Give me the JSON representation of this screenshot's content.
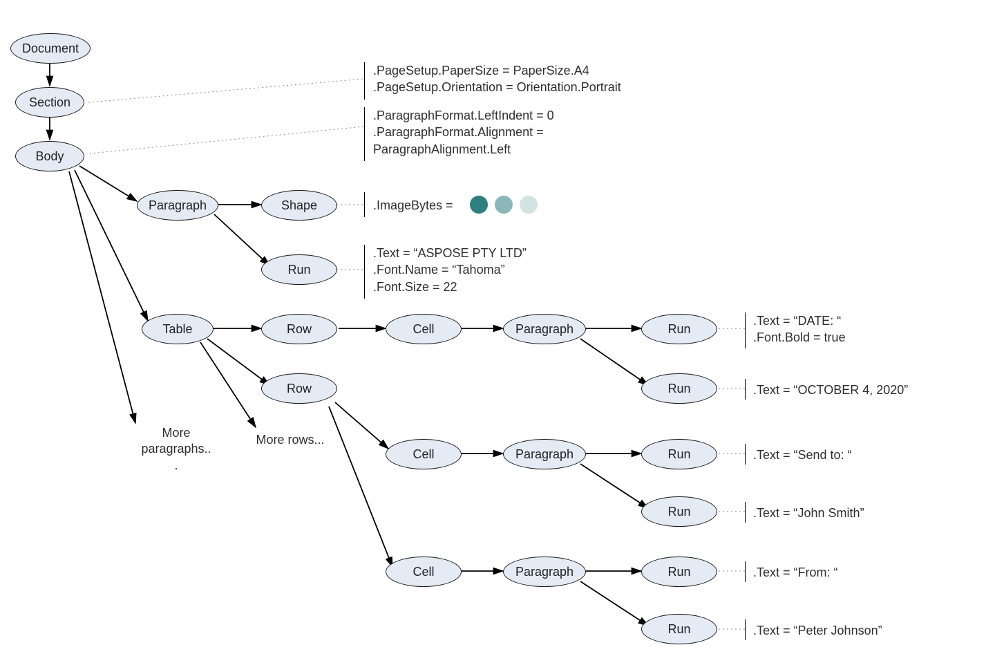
{
  "nodes": {
    "document": "Document",
    "section": "Section",
    "body": "Body",
    "paragraph1": "Paragraph",
    "shape": "Shape",
    "run1": "Run",
    "table": "Table",
    "row1": "Row",
    "row2": "Row",
    "cell1": "Cell",
    "paragraph2": "Paragraph",
    "run2": "Run",
    "run3": "Run",
    "cell2": "Cell",
    "paragraph3": "Paragraph",
    "run4": "Run",
    "run5": "Run",
    "cell3": "Cell",
    "paragraph4": "Paragraph",
    "run6": "Run",
    "run7": "Run"
  },
  "annotations": {
    "section": {
      "lines": [
        ".PageSetup.PaperSize = PaperSize.A4",
        ".PageSetup.Orientation = Orientation.Portrait"
      ]
    },
    "body": {
      "lines": [
        ".ParagraphFormat.LeftIndent = 0",
        ".ParagraphFormat.Alignment =",
        "ParagraphAlignment.Left"
      ]
    },
    "shape": {
      "label": ".ImageBytes ="
    },
    "run1": {
      "lines": [
        ".Text = “ASPOSE PTY LTD”",
        ".Font.Name = “Tahoma”",
        ".Font.Size = 22"
      ]
    },
    "run2": {
      "lines": [
        ".Text = “DATE: “",
        ".Font.Bold = true"
      ]
    },
    "run3": {
      "lines": [
        ".Text = “OCTOBER 4, 2020”"
      ]
    },
    "run4": {
      "lines": [
        ".Text = “Send to: “"
      ]
    },
    "run5": {
      "lines": [
        ".Text = “John Smith”"
      ]
    },
    "run6": {
      "lines": [
        ".Text = “From: “"
      ]
    },
    "run7": {
      "lines": [
        ".Text = “Peter Johnson”"
      ]
    }
  },
  "notes": {
    "more_paragraphs": "More\nparagraphs..\n.",
    "more_rows": "More rows..."
  },
  "colors": {
    "node_fill": "#e4ebf4",
    "node_stroke": "#1a1a1a",
    "dot1": "#2d7f82",
    "dot2": "#8cb7b9",
    "dot3": "#d3e2e2"
  }
}
